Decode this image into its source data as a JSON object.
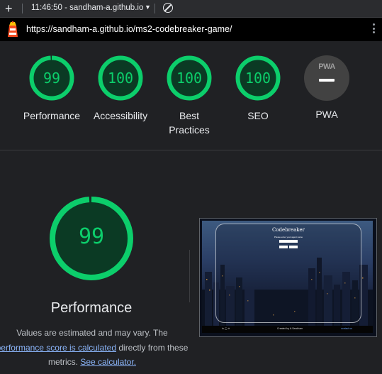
{
  "topbar": {
    "time_and_url": "11:46:50 - sandham-a.github.io",
    "plus_icon": "plus-icon",
    "dropdown_icon": "caret-down-icon",
    "block_icon": "block-icon"
  },
  "urlbar": {
    "url": "https://sandham-a.github.io/ms2-codebreaker-game/",
    "favicon": "lighthouse-icon",
    "menu_icon": "kebab-menu-icon"
  },
  "scores": [
    {
      "label": "Performance",
      "score": "99",
      "value": 99
    },
    {
      "label": "Accessibility",
      "score": "100",
      "value": 100
    },
    {
      "label": "Best Practices",
      "score": "100",
      "value": 100
    },
    {
      "label": "SEO",
      "score": "100",
      "value": 100
    }
  ],
  "pwa": {
    "badge": "PWA",
    "label": "PWA"
  },
  "detail": {
    "score": "99",
    "value": 99,
    "title": "Performance",
    "note_prefix": "Values are estimated and may vary. The ",
    "note_link": "performance score is calculated",
    "note_middle": " directly from these metrics. ",
    "note_link2": "See calculator.",
    "note_suffix": ""
  },
  "screenshot": {
    "title": "Codebreaker",
    "subtitle": "Please enter your agent name",
    "footer_credit": "Created by A.Sandham",
    "footer_contact": "contact us"
  },
  "colors": {
    "pass": "#0cce6b",
    "pass_bg": "#0b3a24",
    "background": "#202124"
  }
}
